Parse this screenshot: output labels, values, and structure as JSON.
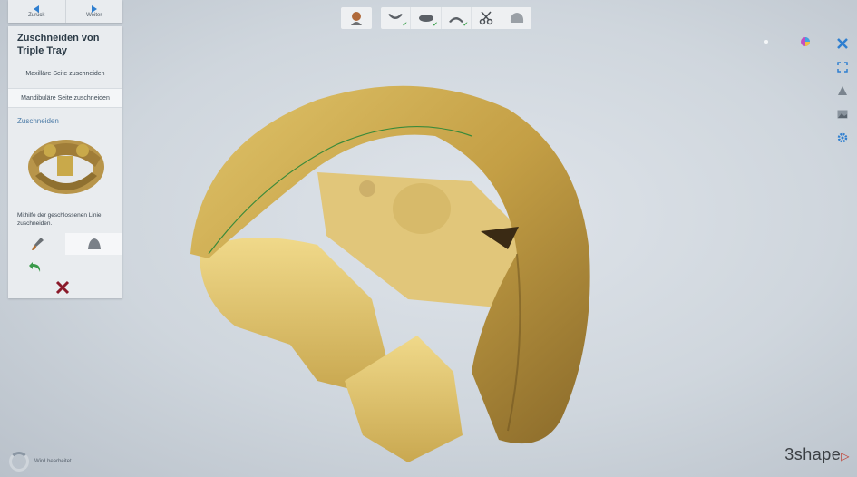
{
  "nav": {
    "back_label": "Zurück",
    "next_label": "Weiter"
  },
  "side_panel": {
    "title": "Zuschneiden von Triple Tray",
    "steps": [
      {
        "label": "Maxilläre Seite zuschneiden"
      },
      {
        "label": "Mandibuläre Seite zuschneiden"
      }
    ],
    "section_title": "Zuschneiden",
    "hint": "Mithilfe der geschlossenen Linie zuschneiden."
  },
  "status": {
    "text": "Wird bearbeitet..."
  },
  "brand": {
    "name": "3shape"
  },
  "colors": {
    "accent": "#2f7fd0",
    "model": "#c9a94a",
    "cancel": "#8a1a2a",
    "check": "#3aa04a"
  }
}
